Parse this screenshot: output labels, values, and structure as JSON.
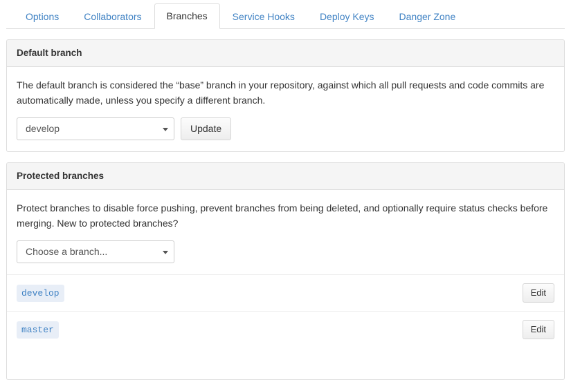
{
  "tabs": [
    {
      "label": "Options",
      "selected": false
    },
    {
      "label": "Collaborators",
      "selected": false
    },
    {
      "label": "Branches",
      "selected": true
    },
    {
      "label": "Service Hooks",
      "selected": false
    },
    {
      "label": "Deploy Keys",
      "selected": false
    },
    {
      "label": "Danger Zone",
      "selected": false
    }
  ],
  "default_branch_panel": {
    "title": "Default branch",
    "description": "The default branch is considered the “base” branch in your repository, against which all pull requests and code commits are automatically made, unless you specify a different branch.",
    "select_value": "develop",
    "select_caret": "chevron-down-icon",
    "update_label": "Update"
  },
  "protected_branches_panel": {
    "title": "Protected branches",
    "description": "Protect branches to disable force pushing, prevent branches from being deleted, and optionally require status checks before merging. New to protected branches?",
    "select_value": "Choose a branch...",
    "select_caret": "chevron-down-icon",
    "rows": [
      {
        "name": "develop",
        "edit_label": "Edit"
      },
      {
        "name": "master",
        "edit_label": "Edit"
      }
    ]
  },
  "colors": {
    "link": "#4183c4",
    "text": "#333333",
    "panel_border": "#dddddd",
    "panel_heading_bg": "#f5f5f5",
    "badge_bg": "#e8eef7",
    "badge_text": "#4183c4",
    "button_bg": "#f5f5f5",
    "divider": "#eeeeee"
  }
}
